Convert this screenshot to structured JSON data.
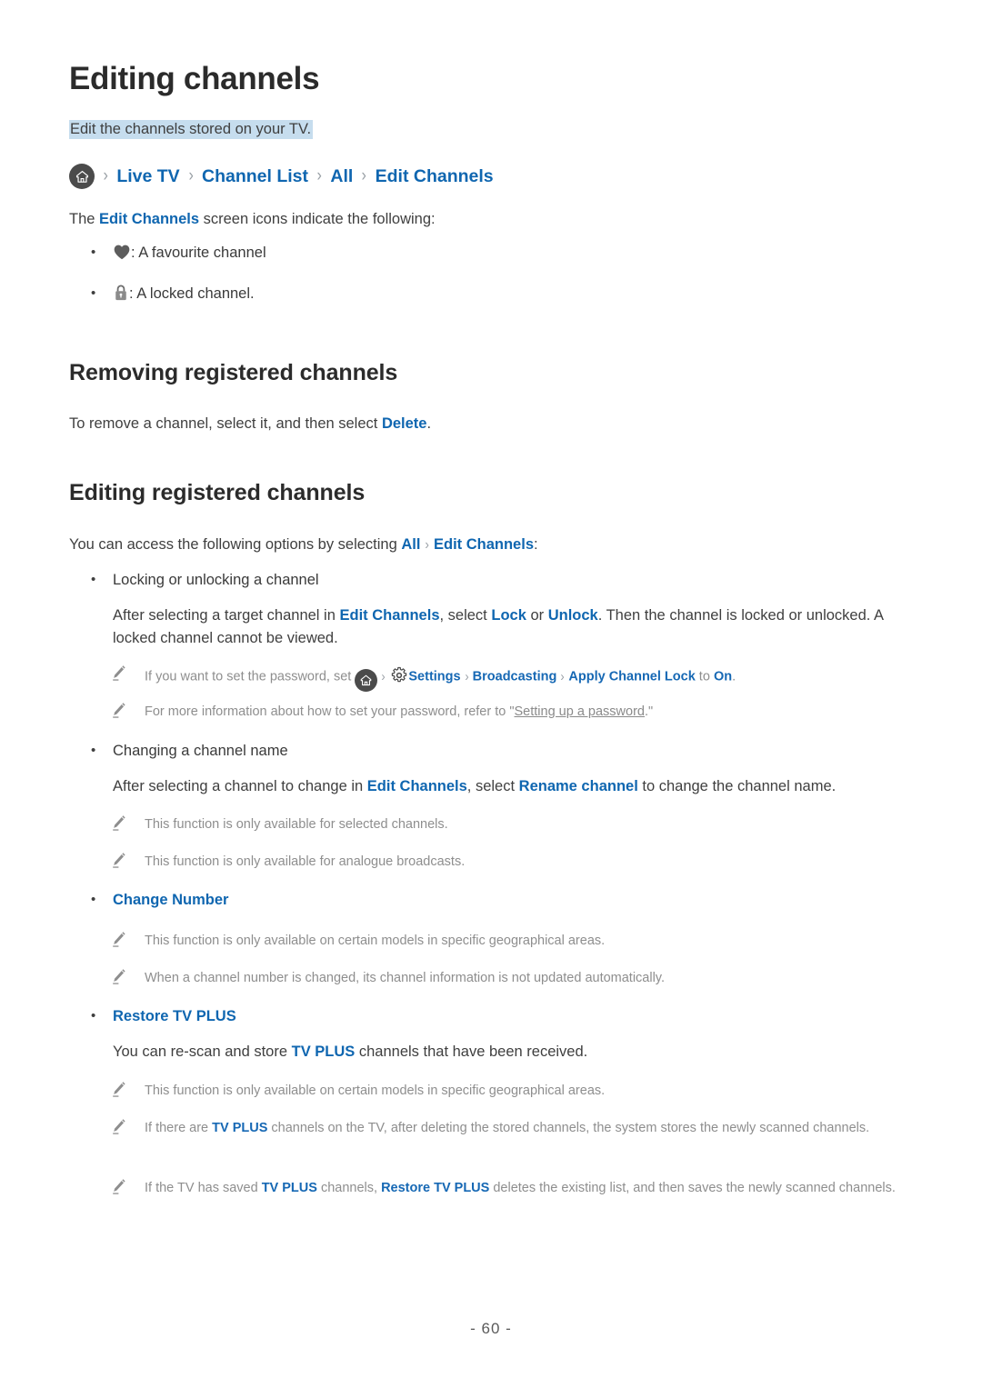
{
  "page": {
    "title": "Editing channels",
    "intro_highlighted": "Edit the channels stored on your TV.",
    "page_number": "- 60 -"
  },
  "breadcrumb": {
    "home_icon": "home-icon",
    "separator": "›",
    "items": [
      "Live TV",
      "Channel List",
      "All",
      "Edit Channels"
    ]
  },
  "icons_intro": {
    "before_link": "The ",
    "link": "Edit Channels",
    "after_link": " screen icons indicate the following:"
  },
  "icon_legend": [
    {
      "icon": "heart-icon",
      "text": ": A favourite channel"
    },
    {
      "icon": "lock-icon",
      "text": ": A locked channel."
    }
  ],
  "removing_section": {
    "heading": "Removing registered channels",
    "text_before": "To remove a channel, select it, and then select ",
    "link": "Delete",
    "text_after": "."
  },
  "editing_section": {
    "heading": "Editing registered channels",
    "intro_before": "You can access the following options by selecting ",
    "intro_link1": "All",
    "intro_sep": "›",
    "intro_link2": "Edit Channels",
    "intro_after": ":"
  },
  "locking": {
    "bullet": "Locking or unlocking a channel",
    "para_1": "After selecting a target channel in ",
    "para_link1": "Edit Channels",
    "para_2": ", select ",
    "para_link2": "Lock",
    "para_3": " or ",
    "para_link3": "Unlock",
    "para_4": ". Then the channel is locked or unlocked. A locked channel cannot be viewed.",
    "notes": [
      {
        "text_1": "If you want to set the password, set ",
        "home_icon": "home-icon",
        "sep": "›",
        "gear_icon": "gear-icon",
        "link_settings": "Settings",
        "link_broadcasting": "Broadcasting",
        "link_apply": "Apply Channel Lock",
        "text_to": " to ",
        "link_on": "On",
        "text_end": "."
      },
      {
        "text_1": "For more information about how to set your password, refer to \"",
        "ref_link": "Setting up a password",
        "text_end": ".\""
      }
    ]
  },
  "renaming": {
    "bullet": "Changing a channel name",
    "para_1": "After selecting a channel to change in ",
    "para_link1": "Edit Channels",
    "para_2": ", select ",
    "para_link2": "Rename channel",
    "para_3": " to change the channel name.",
    "notes": [
      "This function is only available for selected channels.",
      "This function is only available for analogue broadcasts."
    ]
  },
  "change_number": {
    "bullet_link": "Change Number",
    "notes": [
      "This function is only available on certain models in specific geographical areas.",
      "When a channel number is changed, its channel information is not updated automatically."
    ]
  },
  "restore_tv_plus": {
    "bullet_link": "Restore TV PLUS",
    "para_1": "You can re-scan and store ",
    "para_link": "TV PLUS",
    "para_2": " channels that have been received.",
    "note_1": "This function is only available on certain models in specific geographical areas.",
    "note_2_a": "If there are ",
    "note_2_link": "TV PLUS",
    "note_2_b": " channels on the TV, after deleting the stored channels, the system stores the newly scanned channels.",
    "note_3_a": "If the TV has saved ",
    "note_3_link1": "TV PLUS",
    "note_3_b": " channels, ",
    "note_3_link2": "Restore TV PLUS",
    "note_3_c": " deletes the existing list, and then saves the newly scanned channels."
  },
  "colors": {
    "link_blue": "#0f66b0",
    "note_gray": "#8e8e8e",
    "highlight": "#c6ddee",
    "text": "#3f3f3f",
    "heading": "#2b2b2b"
  }
}
